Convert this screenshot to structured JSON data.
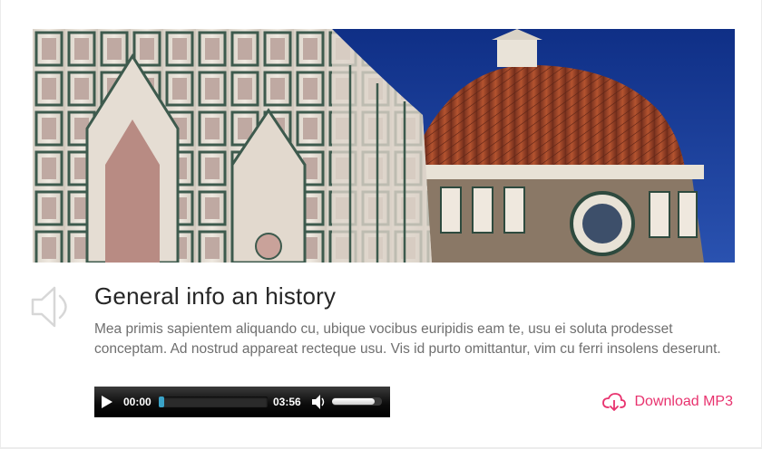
{
  "item": {
    "title": "General info an history",
    "description": "Mea primis sapientem aliquando cu, ubique vocibus euripidis eam te, usu ei soluta prodesset conceptam. Ad nostrud appareat recteque usu. Vis id purto omittantur, vim cu ferri insolens deserunt.",
    "image_alt": "Cathedral dome and facade"
  },
  "player": {
    "current_time": "00:00",
    "duration": "03:56",
    "progress_fraction": 0.05,
    "volume_fraction": 0.85
  },
  "download": {
    "label": "Download MP3",
    "icon": "cloud-download-icon"
  },
  "colors": {
    "accent": "#e8326e",
    "title": "#262626",
    "text": "#6f6f6f",
    "sky": "#1b3a8a",
    "dome": "#a8482c"
  }
}
